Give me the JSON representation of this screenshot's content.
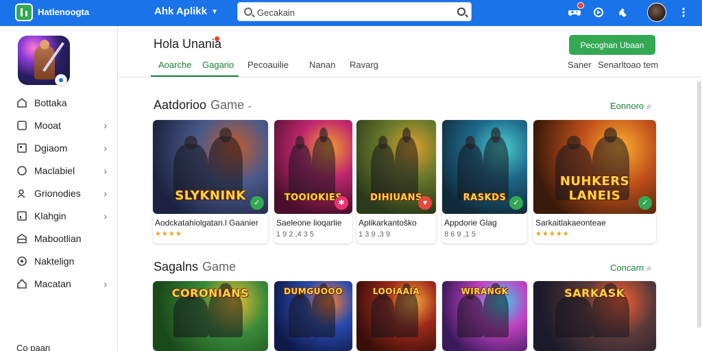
{
  "topbar": {
    "app_name": "Hatlenoogta",
    "apps_menu": "Ahk Aplikk",
    "search_placeholder": "Gecakain",
    "icons": [
      "gamepad-icon",
      "notification-icon",
      "refresh-icon",
      "puzzle-icon",
      "more-vert-icon"
    ]
  },
  "sidebar": {
    "items": [
      {
        "label": "Bottaka",
        "icon": "home-icon",
        "arrow": false
      },
      {
        "label": "Mooat",
        "icon": "square-icon",
        "arrow": true
      },
      {
        "label": "Dgiaom",
        "icon": "grid-icon",
        "arrow": true
      },
      {
        "label": "Maclabiel",
        "icon": "circle-icon",
        "arrow": true
      },
      {
        "label": "Grionodies",
        "icon": "person-icon",
        "arrow": true
      },
      {
        "label": "Klahgin",
        "icon": "chart-icon",
        "arrow": true
      },
      {
        "label": "Mabootlian",
        "icon": "store-icon",
        "arrow": false
      },
      {
        "label": "Naktelign",
        "icon": "target-icon",
        "arrow": false
      },
      {
        "label": "Macatan",
        "icon": "house-icon",
        "arrow": true
      }
    ],
    "footer": "Co paan"
  },
  "main": {
    "title": "Hola Unania",
    "install_button": "Pecoghan Ubaan",
    "tabs": [
      "Aoarche",
      "Gagario",
      "Pecoauilie",
      "Nanan",
      "Ravarg"
    ],
    "active_tab": 1,
    "right_links": [
      "Saner",
      "Senarltoao tem"
    ]
  },
  "sections": [
    {
      "title": "Aatdorioo",
      "subtitle": "Game",
      "link": "Eonnoro",
      "cards": [
        {
          "name": "Aodckatahiolgatan.l Gaanier",
          "meta": "",
          "stars": "★★★★",
          "logo": "SLYKNINK",
          "badge": "✓",
          "badge_color": "#34a853",
          "colors": [
            "#1b2340",
            "#4a5a8a",
            "#c85a2a"
          ]
        },
        {
          "name": "Saeleone lioqarlie",
          "meta": "1 9 2 ,4 3 5",
          "stars": "",
          "logo": "TOOIOKIES",
          "badge": "✱",
          "badge_color": "#e8336d",
          "colors": [
            "#4a0f2a",
            "#c0266e",
            "#f0a030"
          ]
        },
        {
          "name": "Aplikarkantoško",
          "meta": "1 3 9 ,3 9",
          "stars": "",
          "logo": "DIHIUANS",
          "badge": "♥",
          "badge_color": "#e8473b",
          "colors": [
            "#2a3a1a",
            "#6b7a2a",
            "#e0a030"
          ]
        },
        {
          "name": "Appdorie Glag",
          "meta": "8 6 9 ,1 5",
          "stars": "",
          "logo": "RASKDS",
          "badge": "✓",
          "badge_color": "#34a853",
          "colors": [
            "#0f2a3a",
            "#1f6a8a",
            "#4ad0d0"
          ]
        },
        {
          "name": "Sarkaitlakaeonteae",
          "meta": "",
          "stars": "★★★★★",
          "logo": "NUHKERS LANEIS",
          "badge": "✓",
          "badge_color": "#34a853",
          "colors": [
            "#3a1a0a",
            "#c0501a",
            "#ffb030"
          ]
        }
      ]
    },
    {
      "title": "Sagalns",
      "subtitle": "Game",
      "link": "Concarn",
      "cards": [
        {
          "name": "",
          "meta": "",
          "stars": "",
          "logo": "CORONIANS",
          "badge": "",
          "badge_color": "",
          "colors": [
            "#1a4a1a",
            "#3a8a3a",
            "#f0c030"
          ]
        },
        {
          "name": "",
          "meta": "",
          "stars": "",
          "logo": "DUMGUOOO",
          "badge": "",
          "badge_color": "",
          "colors": [
            "#0f1a4a",
            "#2a4ab0",
            "#ff8030"
          ]
        },
        {
          "name": "",
          "meta": "",
          "stars": "",
          "logo": "LOOIAAIA",
          "badge": "",
          "badge_color": "",
          "colors": [
            "#3a0f0a",
            "#a02a1a",
            "#ffb040"
          ]
        },
        {
          "name": "",
          "meta": "",
          "stars": "",
          "logo": "WIRANGK",
          "badge": "",
          "badge_color": "",
          "colors": [
            "#3a1a5a",
            "#c040c0",
            "#40d0f0"
          ]
        },
        {
          "name": "",
          "meta": "",
          "stars": "",
          "logo": "SARKASK",
          "badge": "",
          "badge_color": "",
          "colors": [
            "#1a1a2a",
            "#5a3a3a",
            "#ff6030"
          ]
        }
      ]
    }
  ]
}
